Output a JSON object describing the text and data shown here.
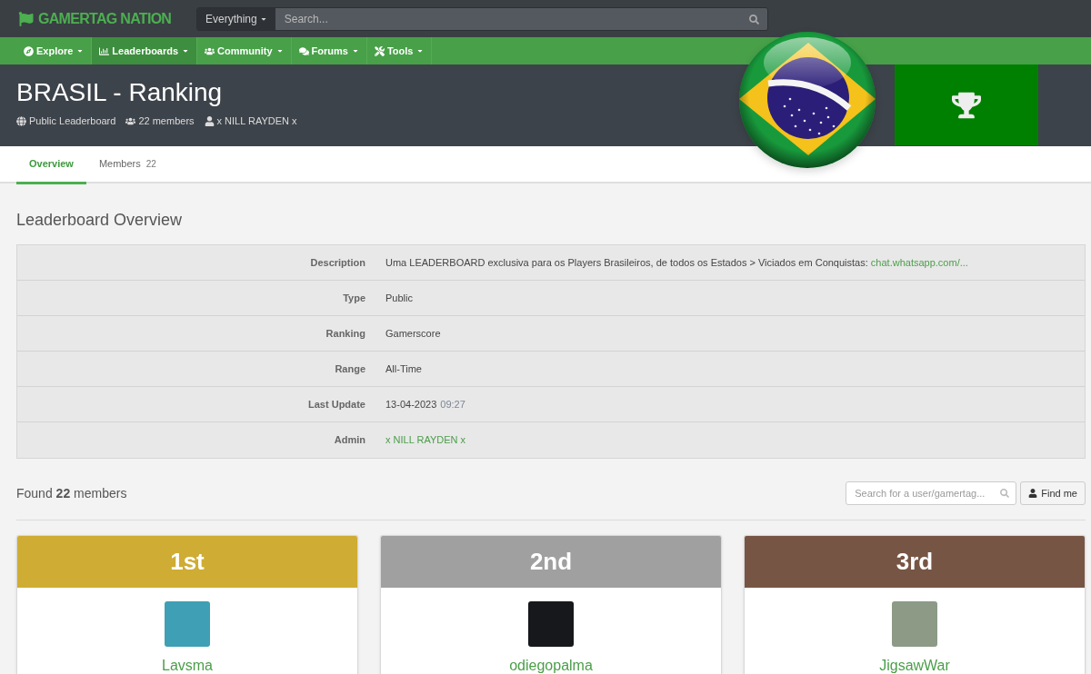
{
  "brand": {
    "name": "GAMERTAG NATION"
  },
  "search": {
    "scope": "Everything",
    "placeholder": "Search..."
  },
  "nav": [
    {
      "label": "Explore",
      "selected": false
    },
    {
      "label": "Leaderboards",
      "selected": true
    },
    {
      "label": "Community",
      "selected": false
    },
    {
      "label": "Forums",
      "selected": false
    },
    {
      "label": "Tools",
      "selected": false
    }
  ],
  "header": {
    "title": "BRASIL - Ranking",
    "meta": [
      "Public Leaderboard",
      "22 members",
      "x NILL RAYDEN x"
    ]
  },
  "tabs": [
    {
      "label": "Overview",
      "selected": true
    },
    {
      "label": "Members",
      "count": "22",
      "selected": false
    }
  ],
  "overview": {
    "title": "Leaderboard Overview",
    "rows": [
      {
        "kind": "text_link",
        "label": "Description",
        "value": "Uma LEADERBOARD exclusiva para os Players Brasileiros, de todos os Estados > Viciados em Conquistas:",
        "link": "chat.whatsapp.com/..."
      },
      {
        "kind": "text",
        "label": "Type",
        "value": "Public"
      },
      {
        "kind": "text",
        "label": "Ranking",
        "value": "Gamerscore"
      },
      {
        "kind": "text",
        "label": "Range",
        "value": "All-Time"
      },
      {
        "kind": "datetime",
        "label": "Last Update",
        "value": "13-04-2023",
        "time": "09:27"
      },
      {
        "kind": "link",
        "label": "Admin",
        "link": "x NILL RAYDEN x"
      }
    ]
  },
  "members": {
    "found": "Found **22** members",
    "search_placeholder": "Search for a user/gamertag...",
    "find_button": "Find me"
  },
  "podium": [
    {
      "place": "1st",
      "name": "Lavsma",
      "color": "#cfac33"
    },
    {
      "place": "2nd",
      "name": "odiegopalma",
      "color": "#a0a0a0"
    },
    {
      "place": "3rd",
      "name": "JigsawWar",
      "color": "#775544"
    }
  ]
}
